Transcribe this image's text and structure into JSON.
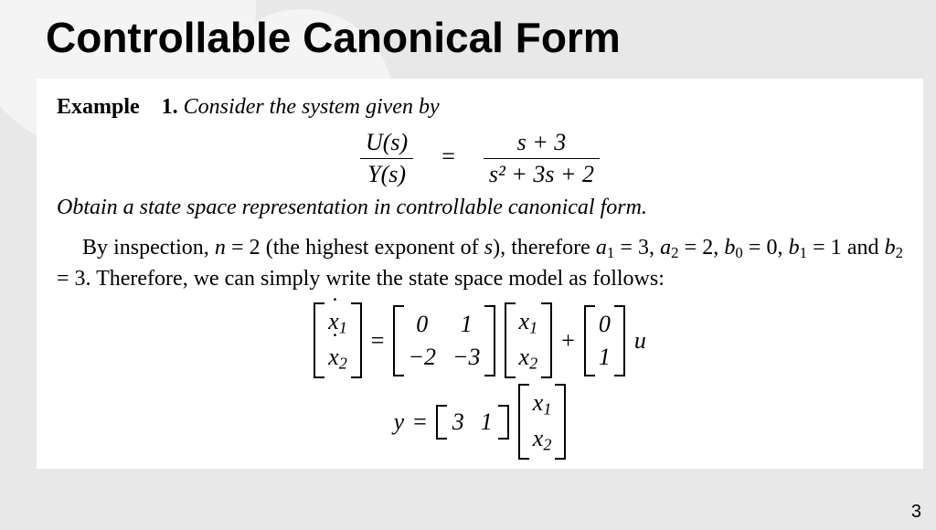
{
  "title": "Controllable Canonical Form",
  "example_label": "Example",
  "example_number": "1.",
  "example_prompt": "Consider the system given by",
  "tf": {
    "lhs_num": "U(s)",
    "lhs_den": "Y(s)",
    "eq": "=",
    "rhs_num": "s + 3",
    "rhs_den": "s² + 3s + 2"
  },
  "task_line": "Obtain a state space representation in controllable canonical form.",
  "body_html": "By inspection, <i>n</i> = 2 (the highest exponent of <i>s</i>), therefore <i>a</i><sub>1</sub> = 3, <i>a</i><sub>2</sub> = 2, <i>b</i><sub>0</sub> = 0, <i>b</i><sub>1</sub> = 1 and <i>b</i><sub>2</sub> = 3. Therefore, we can simply write the state space model as follows:",
  "state_eq": {
    "xdot": [
      "ẋ₁",
      "ẋ₂"
    ],
    "A": [
      [
        "0",
        "1"
      ],
      [
        "−2",
        "−3"
      ]
    ],
    "x": [
      "x₁",
      "x₂"
    ],
    "B": [
      "0",
      "1"
    ],
    "u": "u",
    "eq": "=",
    "plus": "+"
  },
  "output_eq": {
    "y": "y",
    "eq": "=",
    "C": [
      "3",
      "1"
    ],
    "x": [
      "x₁",
      "x₂"
    ]
  },
  "page_number": "3"
}
